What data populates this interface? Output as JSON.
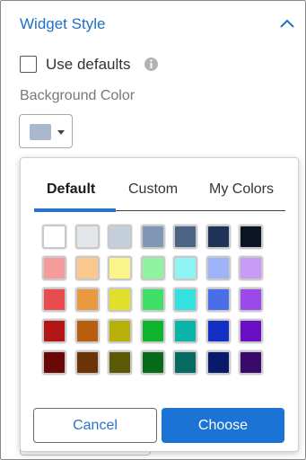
{
  "section": {
    "title": "Widget Style",
    "collapse_icon": "chevron-up-icon",
    "accent": "#1f6fc5"
  },
  "use_defaults": {
    "label": "Use defaults",
    "checked": false,
    "info_icon": "info-icon"
  },
  "background": {
    "label": "Background Color",
    "current_color": "#a9b8cc"
  },
  "picker": {
    "tabs": [
      {
        "label": "Default",
        "active": true
      },
      {
        "label": "Custom",
        "active": false
      },
      {
        "label": "My Colors",
        "active": false
      }
    ],
    "swatches": [
      [
        "#ffffff",
        "#e3e7ec",
        "#c4cfdc",
        "#7f97b4",
        "#4d6384",
        "#1f3356",
        "#0b1422"
      ],
      [
        "#f49b9b",
        "#fbc78e",
        "#fbf488",
        "#8ef4a0",
        "#8ef4f4",
        "#9fb4f8",
        "#c79bf4"
      ],
      [
        "#e84c4c",
        "#ea9a3e",
        "#e0e02c",
        "#3ee06a",
        "#34e0e0",
        "#4a6ee8",
        "#9a4ae8"
      ],
      [
        "#b21616",
        "#b85e0e",
        "#b8b00a",
        "#0eb42e",
        "#0ab4a8",
        "#1430c4",
        "#6a10c4"
      ],
      [
        "#6a0808",
        "#6a3406",
        "#5a5a06",
        "#066a1a",
        "#066a62",
        "#0a1a6a",
        "#3a0a6a"
      ]
    ],
    "cancel_label": "Cancel",
    "choose_label": "Choose",
    "primary_color": "#1a73d5"
  }
}
